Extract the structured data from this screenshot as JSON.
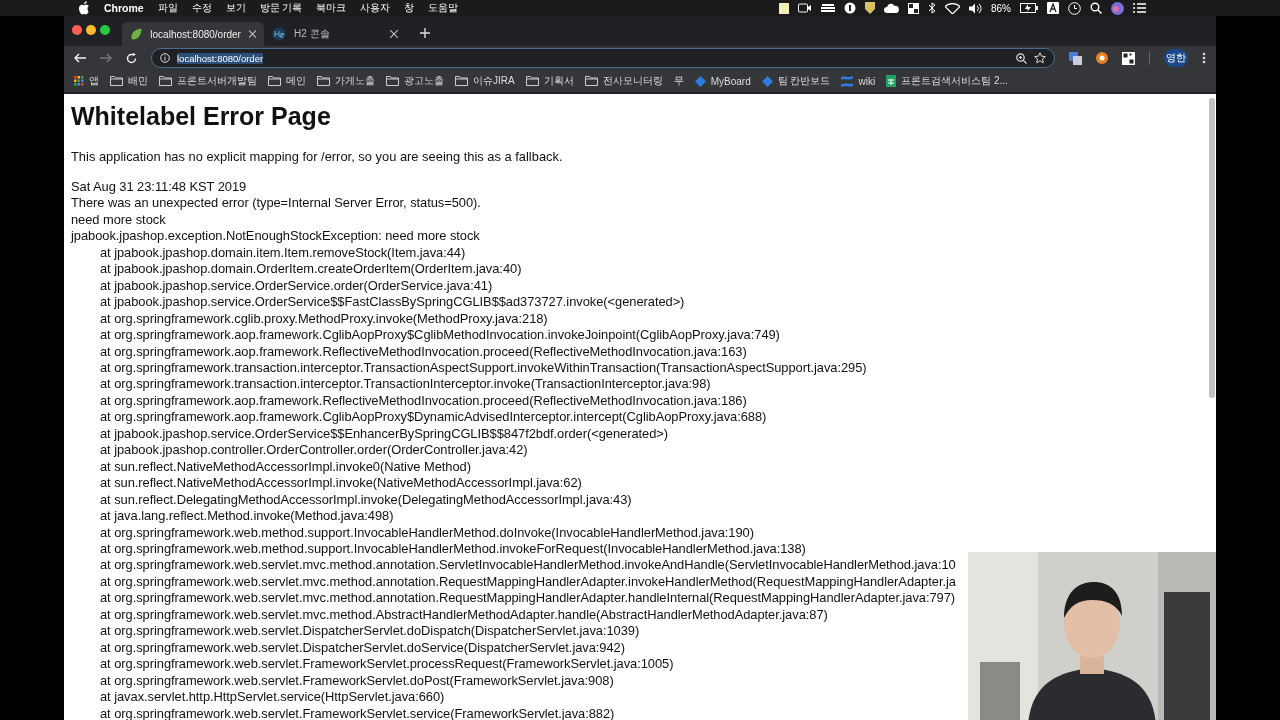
{
  "menubar": {
    "app": "Chrome",
    "menus": [
      "파일",
      "수정",
      "보기",
      "방문 기록",
      "북마크",
      "사용자",
      "창",
      "도움말"
    ],
    "battery": "86%"
  },
  "tabs": [
    {
      "title": "localhost:8080/order",
      "selected": true,
      "kind": "leaf"
    },
    {
      "title": "H2 콘솔",
      "selected": false,
      "kind": "h2"
    }
  ],
  "address": {
    "url": "localhost:8080/order"
  },
  "profile": {
    "initials": "영한"
  },
  "bookmarks": [
    {
      "label": "앱",
      "kind": "apps"
    },
    {
      "label": "배민",
      "kind": "folder"
    },
    {
      "label": "프론트서버개발팀",
      "kind": "folder"
    },
    {
      "label": "메인",
      "kind": "folder"
    },
    {
      "label": "가게노출",
      "kind": "folder"
    },
    {
      "label": "광고노출",
      "kind": "folder"
    },
    {
      "label": "이슈JIRA",
      "kind": "folder"
    },
    {
      "label": "기획서",
      "kind": "folder"
    },
    {
      "label": "전사모니터링",
      "kind": "folder"
    },
    {
      "label": "무",
      "kind": "text"
    },
    {
      "label": "MyBoard",
      "kind": "diamond"
    },
    {
      "label": "팀 칸반보드",
      "kind": "diamond"
    },
    {
      "label": "wiki",
      "kind": "confluence"
    },
    {
      "label": "프론트검색서비스팀 2...",
      "kind": "sheet"
    }
  ],
  "page": {
    "heading": "Whitelabel Error Page",
    "intro": "This application has no explicit mapping for /error, so you are seeing this as a fallback.",
    "lines": [
      "Sat Aug 31 23:11:48 KST 2019",
      "There was an unexpected error (type=Internal Server Error, status=500).",
      "need more stock",
      "jpabook.jpashop.exception.NotEnoughStockException: need more stock"
    ],
    "trace": [
      "at jpabook.jpashop.domain.item.Item.removeStock(Item.java:44)",
      "at jpabook.jpashop.domain.OrderItem.createOrderItem(OrderItem.java:40)",
      "at jpabook.jpashop.service.OrderService.order(OrderService.java:41)",
      "at jpabook.jpashop.service.OrderService$$FastClassBySpringCGLIB$$ad373727.invoke(<generated>)",
      "at org.springframework.cglib.proxy.MethodProxy.invoke(MethodProxy.java:218)",
      "at org.springframework.aop.framework.CglibAopProxy$CglibMethodInvocation.invokeJoinpoint(CglibAopProxy.java:749)",
      "at org.springframework.aop.framework.ReflectiveMethodInvocation.proceed(ReflectiveMethodInvocation.java:163)",
      "at org.springframework.transaction.interceptor.TransactionAspectSupport.invokeWithinTransaction(TransactionAspectSupport.java:295)",
      "at org.springframework.transaction.interceptor.TransactionInterceptor.invoke(TransactionInterceptor.java:98)",
      "at org.springframework.aop.framework.ReflectiveMethodInvocation.proceed(ReflectiveMethodInvocation.java:186)",
      "at org.springframework.aop.framework.CglibAopProxy$DynamicAdvisedInterceptor.intercept(CglibAopProxy.java:688)",
      "at jpabook.jpashop.service.OrderService$$EnhancerBySpringCGLIB$$847f2bdf.order(<generated>)",
      "at jpabook.jpashop.controller.OrderController.order(OrderController.java:42)",
      "at sun.reflect.NativeMethodAccessorImpl.invoke0(Native Method)",
      "at sun.reflect.NativeMethodAccessorImpl.invoke(NativeMethodAccessorImpl.java:62)",
      "at sun.reflect.DelegatingMethodAccessorImpl.invoke(DelegatingMethodAccessorImpl.java:43)",
      "at java.lang.reflect.Method.invoke(Method.java:498)",
      "at org.springframework.web.method.support.InvocableHandlerMethod.doInvoke(InvocableHandlerMethod.java:190)",
      "at org.springframework.web.method.support.InvocableHandlerMethod.invokeForRequest(InvocableHandlerMethod.java:138)",
      "at org.springframework.web.servlet.mvc.method.annotation.ServletInvocableHandlerMethod.invokeAndHandle(ServletInvocableHandlerMethod.java:10",
      "at org.springframework.web.servlet.mvc.method.annotation.RequestMappingHandlerAdapter.invokeHandlerMethod(RequestMappingHandlerAdapter.ja",
      "at org.springframework.web.servlet.mvc.method.annotation.RequestMappingHandlerAdapter.handleInternal(RequestMappingHandlerAdapter.java:797)",
      "at org.springframework.web.servlet.mvc.method.AbstractHandlerMethodAdapter.handle(AbstractHandlerMethodAdapter.java:87)",
      "at org.springframework.web.servlet.DispatcherServlet.doDispatch(DispatcherServlet.java:1039)",
      "at org.springframework.web.servlet.DispatcherServlet.doService(DispatcherServlet.java:942)",
      "at org.springframework.web.servlet.FrameworkServlet.processRequest(FrameworkServlet.java:1005)",
      "at org.springframework.web.servlet.FrameworkServlet.doPost(FrameworkServlet.java:908)",
      "at javax.servlet.http.HttpServlet.service(HttpServlet.java:660)",
      "at org.springframework.web.servlet.FrameworkServlet.service(FrameworkServlet.java:882)"
    ]
  }
}
